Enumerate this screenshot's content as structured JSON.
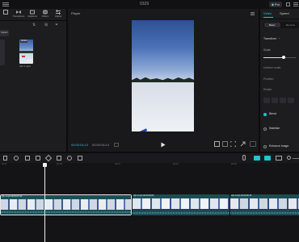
{
  "titlebar": {
    "title": "0329",
    "pro_badge": "Pro"
  },
  "toolbar": {
    "transitions_label": "Transitions",
    "captions_label": "Captions",
    "filters_label": "Filters",
    "adjust_label": "Adjust"
  },
  "media": {
    "import_label": "Import",
    "clip_badge": "Added",
    "clip_name": "clip 1.mp4",
    "clip_duration": "00:06"
  },
  "player": {
    "title": "Player",
    "timecode_current": "00:00:04:13",
    "timecode_total": "00:00:04:14"
  },
  "inspector": {
    "tabs": [
      "Video",
      "Speed"
    ],
    "subtabs": [
      "Basic",
      "Remove"
    ],
    "transform_label": "Transform",
    "scale_label": "Scale",
    "uniform_scale_label": "Uniform scale",
    "position_label": "Position",
    "rotate_label": "Rotate",
    "blend_label": "Blend",
    "stabilize_label": "Stabilize",
    "enhance_label": "Enhance image",
    "scale_level": 0.62
  },
  "timeline": {
    "ruler_marks": [
      "00:00",
      "|00:05",
      "|00:10",
      "|00:15",
      "|00:20"
    ],
    "clip1_label": "clip 1.mp4  00:00:07:22",
    "clip2_label": "clip 2.mp4  00:00:03:05",
    "clip3_label": "clip 3.mp4  00:00:06:15"
  },
  "colors": {
    "accent": "#22c3d0",
    "panel": "#1d1d20",
    "background": "#141416",
    "clip_teal": "#1d4d52"
  }
}
